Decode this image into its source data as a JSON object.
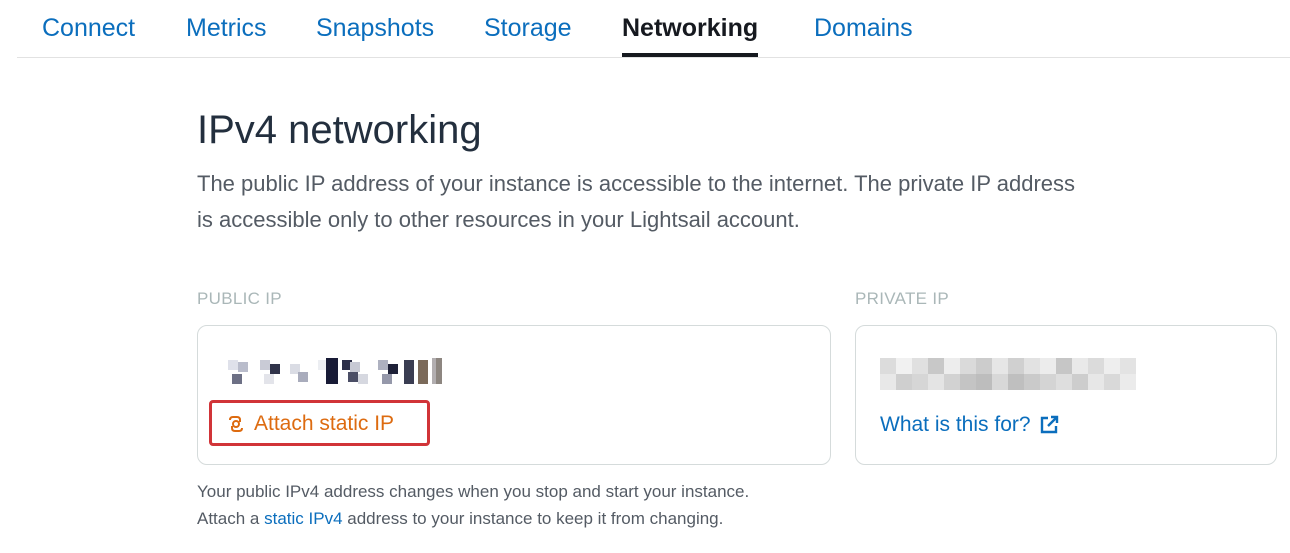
{
  "tabs": [
    {
      "label": "Connect",
      "active": false
    },
    {
      "label": "Metrics",
      "active": false
    },
    {
      "label": "Snapshots",
      "active": false
    },
    {
      "label": "Storage",
      "active": false
    },
    {
      "label": "Networking",
      "active": true
    },
    {
      "label": "Domains",
      "active": false
    }
  ],
  "section": {
    "title": "IPv4 networking",
    "description": "The public IP address of your instance is accessible to the internet. The private IP address is accessible only to other resources in your Lightsail account."
  },
  "public_ip": {
    "label": "PUBLIC IP",
    "attach_button_label": "Attach static IP",
    "attach_icon": "static-ip-chain-icon"
  },
  "private_ip": {
    "label": "PRIVATE IP",
    "help_link_label": "What is this for?",
    "help_link_icon": "external-link-icon"
  },
  "footnote": {
    "line1": "Your public IPv4 address changes when you stop and start your instance.",
    "line2_prefix": "Attach a ",
    "line2_link": "static IPv4",
    "line2_suffix": " address to your instance to keep it from changing."
  },
  "colors": {
    "link": "#0b6ebd",
    "active_tab": "#16191f",
    "accent_orange": "#dd6b10",
    "highlight_red": "#d13438"
  }
}
